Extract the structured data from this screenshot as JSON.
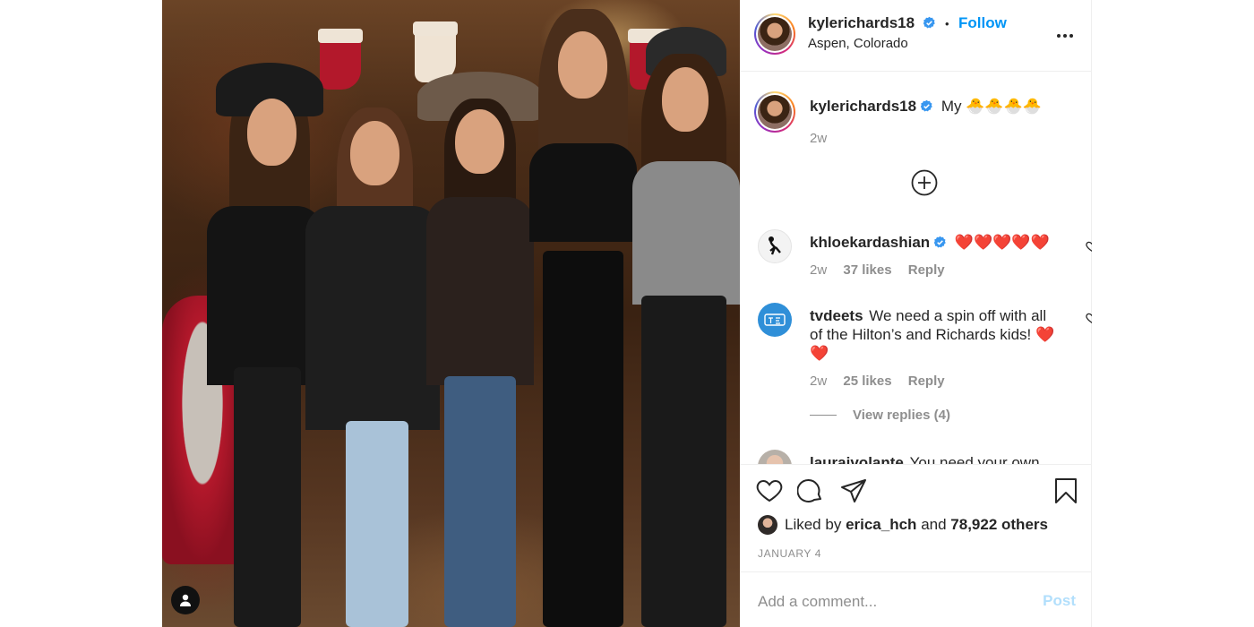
{
  "post": {
    "photo_alt": "",
    "header": {
      "username": "kylerichards18",
      "separator": "•",
      "follow_label": "Follow",
      "location": "Aspen, Colorado",
      "more_icon": "more-horizontal-icon"
    },
    "caption": {
      "username": "kylerichards18",
      "text": "My 🐣🐣🐣🐣",
      "time": "2w"
    },
    "load_more_icon": "plus-circle-icon",
    "comments": [
      {
        "username": "khloekardashian",
        "verified": true,
        "text": "❤️❤️❤️❤️❤️",
        "time": "2w",
        "likes": "37 likes",
        "reply": "Reply"
      },
      {
        "username": "tvdeets",
        "verified": false,
        "text": "We need a spin off with all of the Hilton’s and Richards kids! ❤️❤️",
        "time": "2w",
        "likes": "25 likes",
        "reply": "Reply",
        "view_replies": "View replies (4)"
      },
      {
        "username": "lauraivolante",
        "text": "You need your own"
      }
    ],
    "actions": {
      "like_icon": "heart-icon",
      "comment_icon": "comment-icon",
      "share_icon": "share-icon",
      "save_icon": "bookmark-icon"
    },
    "likes": {
      "prefix": "Liked by",
      "user": "erica_hch",
      "middle": "and",
      "count": "78,922 others"
    },
    "date": "JANUARY 4",
    "add_comment": {
      "placeholder": "Add a comment...",
      "post_label": "Post"
    }
  },
  "colors": {
    "accent": "#0095f6",
    "verified": "#3897f0",
    "muted": "#8e8e8e",
    "post_disabled": "#b2dffc",
    "heart_red": "#ed4956"
  }
}
